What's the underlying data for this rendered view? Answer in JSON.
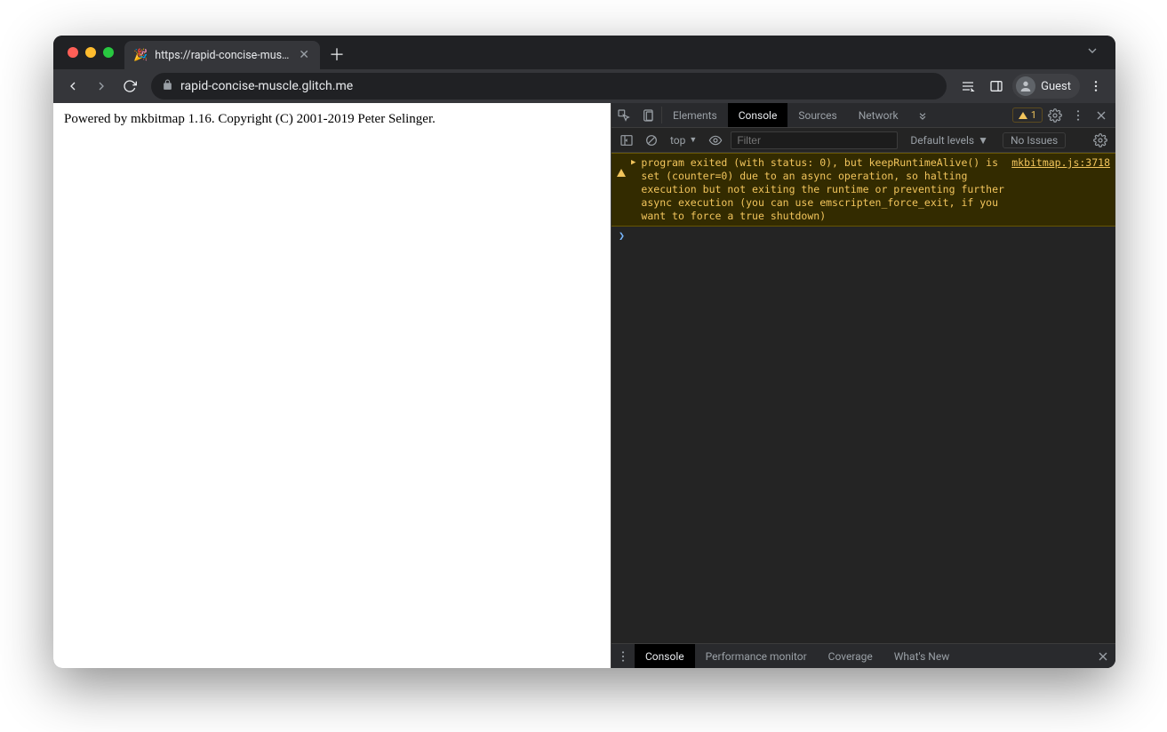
{
  "tab": {
    "favicon": "🎉",
    "title": "https://rapid-concise-muscle.g"
  },
  "toolbar": {
    "url": "rapid-concise-muscle.glitch.me",
    "profile_label": "Guest"
  },
  "page": {
    "body_text": "Powered by mkbitmap 1.16. Copyright (C) 2001-2019 Peter Selinger."
  },
  "devtools": {
    "tabs": {
      "elements": "Elements",
      "console": "Console",
      "sources": "Sources",
      "network": "Network"
    },
    "warn_count": "1",
    "console_toolbar": {
      "context": "top",
      "filter_placeholder": "Filter",
      "levels_label": "Default levels",
      "issues_label": "No Issues"
    },
    "console_messages": [
      {
        "level": "warning",
        "text": "program exited (with status: 0), but keepRuntimeAlive() is set (counter=0) due to an async operation, so halting execution but not exiting the runtime or preventing further async execution (you can use emscripten_force_exit, if you want to force a true shutdown)",
        "source": "mkbitmap.js:3718"
      }
    ],
    "drawer": {
      "tabs": {
        "console": "Console",
        "perf": "Performance monitor",
        "coverage": "Coverage",
        "whatsnew": "What's New"
      }
    }
  }
}
